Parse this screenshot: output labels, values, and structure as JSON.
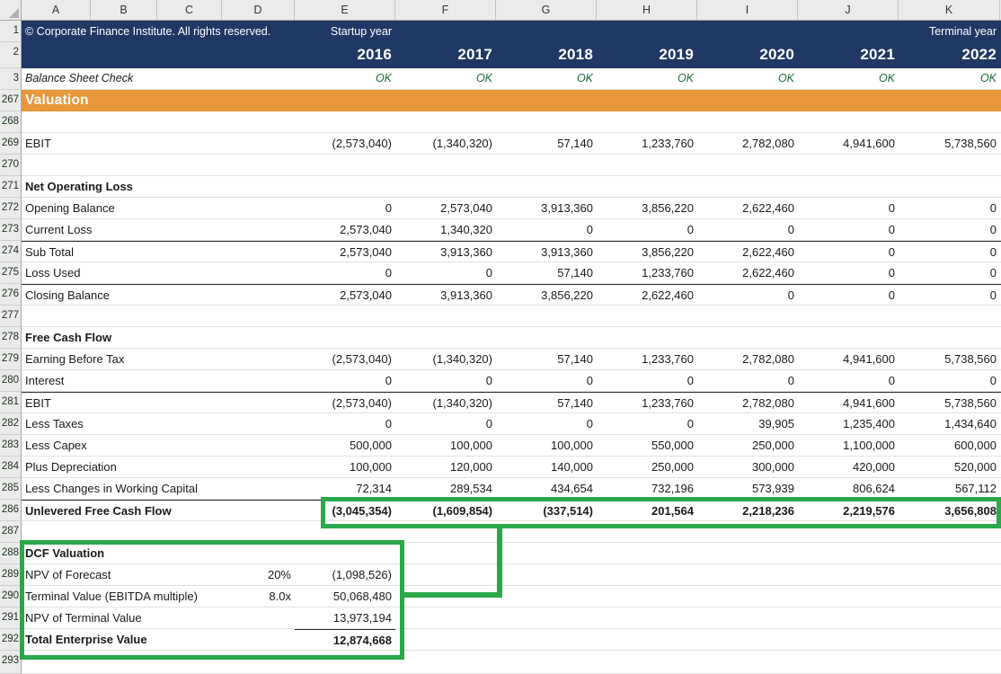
{
  "spreadsheet": {
    "column_headers": [
      "A",
      "B",
      "C",
      "D",
      "E",
      "F",
      "G",
      "H",
      "I",
      "J",
      "K"
    ],
    "row_numbers": [
      "1",
      "2",
      "3",
      "267",
      "268",
      "269",
      "270",
      "271",
      "272",
      "273",
      "274",
      "275",
      "276",
      "277",
      "278",
      "279",
      "280",
      "281",
      "282",
      "283",
      "284",
      "285",
      "286",
      "287",
      "288",
      "289",
      "290",
      "291",
      "292",
      "293"
    ],
    "colors": {
      "header_navy": "#1F3864",
      "section_orange": "#E8983A",
      "highlight_green": "#2AA84A",
      "check_green": "#1F6B3B",
      "gutter_gray": "#EBEBEB"
    }
  },
  "header": {
    "copyright": "© Corporate Finance Institute. All rights reserved.",
    "startup_year_label": "Startup year",
    "terminal_year_label": "Terminal year",
    "years": [
      "2016",
      "2017",
      "2018",
      "2019",
      "2020",
      "2021",
      "2022"
    ],
    "balance_check_label": "Balance Sheet Check",
    "balance_check_values": [
      "OK",
      "OK",
      "OK",
      "OK",
      "OK",
      "OK",
      "OK"
    ]
  },
  "section": {
    "title": "Valuation"
  },
  "ebit_row": {
    "label": "EBIT",
    "values": [
      "(2,573,040)",
      "(1,340,320)",
      "57,140",
      "1,233,760",
      "2,782,080",
      "4,941,600",
      "5,738,560"
    ]
  },
  "net_operating_loss": {
    "title": "Net Operating Loss",
    "rows": [
      {
        "label": "Opening Balance",
        "values": [
          "0",
          "2,573,040",
          "3,913,360",
          "3,856,220",
          "2,622,460",
          "0",
          "0"
        ]
      },
      {
        "label": "Current Loss",
        "values": [
          "2,573,040",
          "1,340,320",
          "0",
          "0",
          "0",
          "0",
          "0"
        ]
      },
      {
        "label": "Sub Total",
        "values": [
          "2,573,040",
          "3,913,360",
          "3,913,360",
          "3,856,220",
          "2,622,460",
          "0",
          "0"
        ]
      },
      {
        "label": "Loss Used",
        "values": [
          "0",
          "0",
          "57,140",
          "1,233,760",
          "2,622,460",
          "0",
          "0"
        ]
      },
      {
        "label": "Closing Balance",
        "values": [
          "2,573,040",
          "3,913,360",
          "3,856,220",
          "2,622,460",
          "0",
          "0",
          "0"
        ]
      }
    ]
  },
  "free_cash_flow": {
    "title": "Free Cash Flow",
    "rows": [
      {
        "label": "Earning Before Tax",
        "values": [
          "(2,573,040)",
          "(1,340,320)",
          "57,140",
          "1,233,760",
          "2,782,080",
          "4,941,600",
          "5,738,560"
        ]
      },
      {
        "label": "Interest",
        "values": [
          "0",
          "0",
          "0",
          "0",
          "0",
          "0",
          "0"
        ]
      },
      {
        "label": "EBIT",
        "values": [
          "(2,573,040)",
          "(1,340,320)",
          "57,140",
          "1,233,760",
          "2,782,080",
          "4,941,600",
          "5,738,560"
        ]
      },
      {
        "label": "Less Taxes",
        "values": [
          "0",
          "0",
          "0",
          "0",
          "39,905",
          "1,235,400",
          "1,434,640"
        ]
      },
      {
        "label": "Less Capex",
        "values": [
          "500,000",
          "100,000",
          "100,000",
          "550,000",
          "250,000",
          "1,100,000",
          "600,000"
        ]
      },
      {
        "label": "Plus Depreciation",
        "values": [
          "100,000",
          "120,000",
          "140,000",
          "250,000",
          "300,000",
          "420,000",
          "520,000"
        ]
      },
      {
        "label": "Less Changes in Working Capital",
        "values": [
          "72,314",
          "289,534",
          "434,654",
          "732,196",
          "573,939",
          "806,624",
          "567,112"
        ]
      }
    ],
    "total": {
      "label": "Unlevered Free Cash Flow",
      "values": [
        "(3,045,354)",
        "(1,609,854)",
        "(337,514)",
        "201,564",
        "2,218,236",
        "2,219,576",
        "3,656,808"
      ]
    }
  },
  "dcf_valuation": {
    "title": "DCF Valuation",
    "rows": [
      {
        "label": "NPV of Forecast",
        "assumption": "20%",
        "value": "(1,098,526)"
      },
      {
        "label": "Terminal Value (EBITDA multiple)",
        "assumption": "8.0x",
        "value": "50,068,480"
      },
      {
        "label": "NPV of Terminal Value",
        "assumption": "",
        "value": "13,973,194"
      }
    ],
    "total": {
      "label": "Total Enterprise Value",
      "assumption": "",
      "value": "12,874,668"
    }
  }
}
